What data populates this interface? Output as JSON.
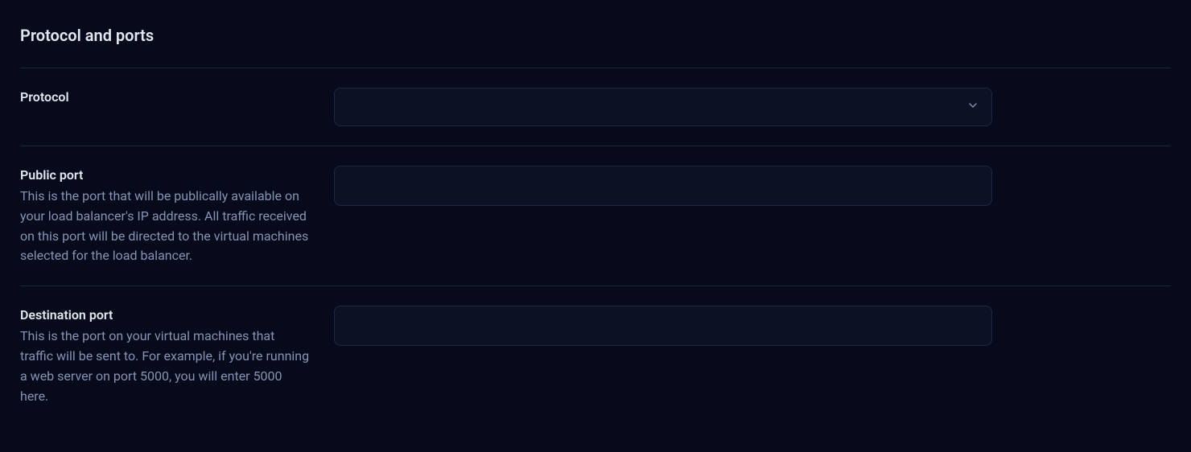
{
  "section": {
    "title": "Protocol and ports"
  },
  "fields": {
    "protocol": {
      "label": "Protocol",
      "value": ""
    },
    "public_port": {
      "label": "Public port",
      "description": "This is the port that will be publically available on your load balancer's IP address. All traffic received on this port will be directed to the virtual machines selected for the load balancer.",
      "value": ""
    },
    "destination_port": {
      "label": "Destination port",
      "description": "This is the port on your virtual machines that traffic will be sent to. For example, if you're running a web server on port 5000, you will enter 5000 here.",
      "value": ""
    }
  }
}
